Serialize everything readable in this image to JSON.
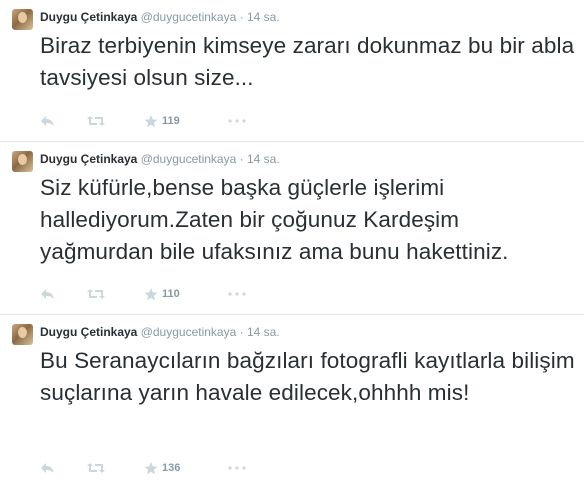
{
  "tweets": [
    {
      "fullname": "Duygu Çetinkaya",
      "username": "@duygucetinkaya",
      "separator": "·",
      "time": "14 sa.",
      "text": "Biraz terbiyenin kimseye zararı dokunmaz bu bir abla tavsiyesi olsun size...",
      "favorites": "119"
    },
    {
      "fullname": "Duygu Çetinkaya",
      "username": "@duygucetinkaya",
      "separator": "·",
      "time": "14 sa.",
      "text": "Siz küfürle,bense başka güçlerle işlerimi hallediyorum.Zaten bir çoğunuz Kardeşim yağmurdan bile ufaksınız ama bunu hakettiniz.",
      "favorites": "110"
    },
    {
      "fullname": "Duygu Çetinkaya",
      "username": "@duygucetinkaya",
      "separator": "·",
      "time": "14 sa.",
      "text": "Bu Seranaycıların bağzıları fotografli kayıtlarla bilişim suçlarına yarın havale edilecek,ohhhh mis!",
      "favorites": "136"
    }
  ],
  "icons": {
    "reply": "reply-icon",
    "retweet": "retweet-icon",
    "favorite": "star-icon",
    "more": "more-icon"
  },
  "colors": {
    "text": "#292f33",
    "muted": "#8899a6",
    "icon": "#ccd6dd",
    "divider": "#e1e8ed"
  }
}
